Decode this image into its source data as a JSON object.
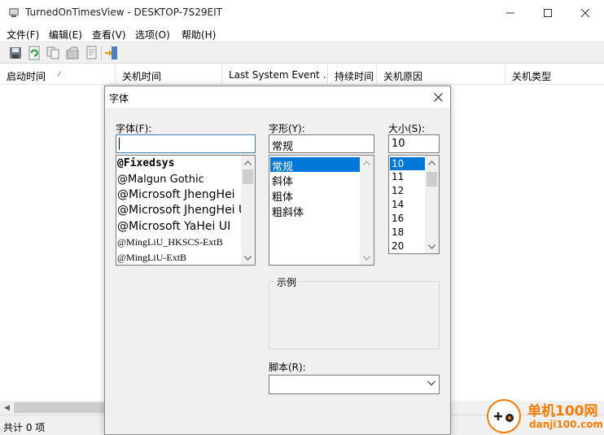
{
  "window": {
    "title": "TurnedOnTimesView  -  DESKTOP-7S29EIT"
  },
  "menu": [
    "文件(F)",
    "编辑(E)",
    "查看(V)",
    "选项(O)",
    "帮助(H)"
  ],
  "toolbar": {
    "icons": [
      "save-icon",
      "refresh-icon",
      "copy-icon",
      "properties-icon",
      "report-icon",
      "exit-icon"
    ]
  },
  "columns": [
    "启动时间",
    "关机时间",
    "Last System Event ...",
    "持续时间",
    "关机原因",
    "关机类型"
  ],
  "columns_sort_indicator": "⁄",
  "status": {
    "text": "共计 0 项"
  },
  "dialog": {
    "title": "字体",
    "font_label": "字体(F):",
    "font_value": "",
    "fonts": [
      "@Fixedsys",
      "@Malgun Gothic",
      "@Microsoft JhengHei",
      "@Microsoft JhengHei U",
      "@Microsoft YaHei UI",
      "@MingLiU_HKSCS-ExtB",
      "@MingLiU-ExtB"
    ],
    "style_label": "字形(Y):",
    "style_value": "常规",
    "styles": [
      "常规",
      "斜体",
      "粗体",
      "粗斜体"
    ],
    "styles_selected": "常规",
    "size_label": "大小(S):",
    "size_value": "10",
    "sizes": [
      "10",
      "11",
      "12",
      "14",
      "16",
      "18",
      "20"
    ],
    "sizes_selected": "10",
    "sample_label": "示例",
    "script_label": "脚本(R):",
    "script_value": ""
  },
  "watermark": {
    "name": "单机100网",
    "url": "danji100.com"
  },
  "colors": {
    "selection": "#0078d7",
    "dialog_bg": "#f0f0f0",
    "watermark": "#ff7a00"
  }
}
